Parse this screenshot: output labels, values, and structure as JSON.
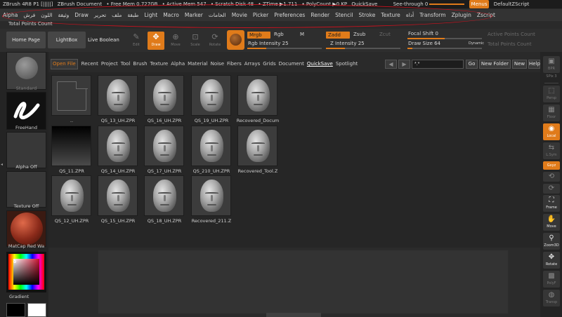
{
  "titlebar": {
    "app_title": "ZBrush 4R8 P1 [|||||]",
    "document": "ZBrush Document",
    "free_mem": "• Free Mem 0.727GB",
    "active_mem": "• Active Mem 547",
    "scratch_disk": "• Scratch Disk 48",
    "ztime": "• ZTime ▶1.711",
    "polycount": "• PolyCount ▶0 KP",
    "quicksave": "QuickSave",
    "see_through": "See-through  0",
    "menus": "Menus",
    "script": "DefaultZScript"
  },
  "menubar": {
    "items": [
      "Alpha",
      "فرش",
      "اللون",
      "وثيقة",
      "Draw",
      "تحرير",
      "ملف",
      "طبقة",
      "Light",
      "Macro",
      "Marker",
      "الخامات",
      "Movie",
      "Picker",
      "Preferences",
      "Render",
      "Stencil",
      "Stroke",
      "Texture",
      "أداة",
      "Transform",
      "Zplugin",
      "Zscript"
    ]
  },
  "total_points_count": "Total Points Count",
  "toolbar": {
    "home_page": "Home Page",
    "lightbox": "LightBox",
    "live_boolean": "Live Boolean",
    "edit": "Edit",
    "draw": "Draw",
    "move": "Move",
    "scale": "Scale",
    "rotate": "Rotate",
    "mrgb": "Mrgb",
    "rgb": "Rgb",
    "m": "M",
    "rgb_intensity": "Rgb Intensity 25",
    "zadd": "Zadd",
    "zsub": "Zsub",
    "zcut": "Zcut",
    "z_intensity": "Z Intensity 25",
    "focal_shift": "Focal Shift 0",
    "draw_size": "Draw Size 64",
    "dynamic": "Dynamic",
    "active_points_count": "Active Points Count",
    "total_points_count": "Total Points Count",
    "rgb_intensity_value": 25,
    "z_intensity_value": 25,
    "focal_shift_value": 0,
    "draw_size_value": 64
  },
  "leftshelf": {
    "standard": "Standard",
    "freehand": "FreeHand",
    "alpha_off": "Alpha Off",
    "texture_off": "Texture Off",
    "matcap": "MatCap Red Wa",
    "gradient": "Gradient"
  },
  "tabs": {
    "items": [
      "Recent",
      "Project",
      "Tool",
      "Brush",
      "Texture",
      "Alpha",
      "Material",
      "Noise",
      "Fibers",
      "Arrays",
      "Grids",
      "Document",
      "QuickSave",
      "Spotlight"
    ],
    "open_file": "Open File",
    "active": "QuickSave"
  },
  "search": {
    "value": "*.*"
  },
  "nav_buttons": {
    "go": "Go",
    "new_folder": "New Folder",
    "new": "New",
    "help": "Help"
  },
  "files": [
    {
      "label": "..",
      "kind": "folder"
    },
    {
      "label": "QS_13_UH.ZPR",
      "kind": "head"
    },
    {
      "label": "QS_16_UH.ZPR",
      "kind": "head"
    },
    {
      "label": "QS_19_UH.ZPR",
      "kind": "head"
    },
    {
      "label": "Recovered_Docum",
      "kind": "head"
    },
    {
      "label": "QS_11.ZPR",
      "kind": "black"
    },
    {
      "label": "QS_14_UH.ZPR",
      "kind": "head"
    },
    {
      "label": "QS_17_UH.ZPR",
      "kind": "head"
    },
    {
      "label": "QS_210_UH.ZPR",
      "kind": "head"
    },
    {
      "label": "Recovered_Tool.Z",
      "kind": "head"
    },
    {
      "label": "QS_12_UH.ZPR",
      "kind": "head"
    },
    {
      "label": "QS_15_UH.ZPR",
      "kind": "head"
    },
    {
      "label": "QS_18_UH.ZPR",
      "kind": "head"
    },
    {
      "label": "Recovered_211.Z",
      "kind": "head"
    }
  ],
  "rightshelf": {
    "bpr": "BPR",
    "spix": "SPix 3",
    "persp": "Persp",
    "floor": "Floor",
    "local": "Local",
    "lsym": "L.Sym",
    "xyz": "Gxyz",
    "frame": "Frame",
    "move": "Move",
    "zoom3d": "Zoom3D",
    "rotate": "Rotate",
    "polyf": "PolyF",
    "transp": "Transp"
  },
  "colors": {
    "accent": "#e07b1a",
    "annotation": "#c8121e",
    "panel": "#2b2b2b"
  }
}
